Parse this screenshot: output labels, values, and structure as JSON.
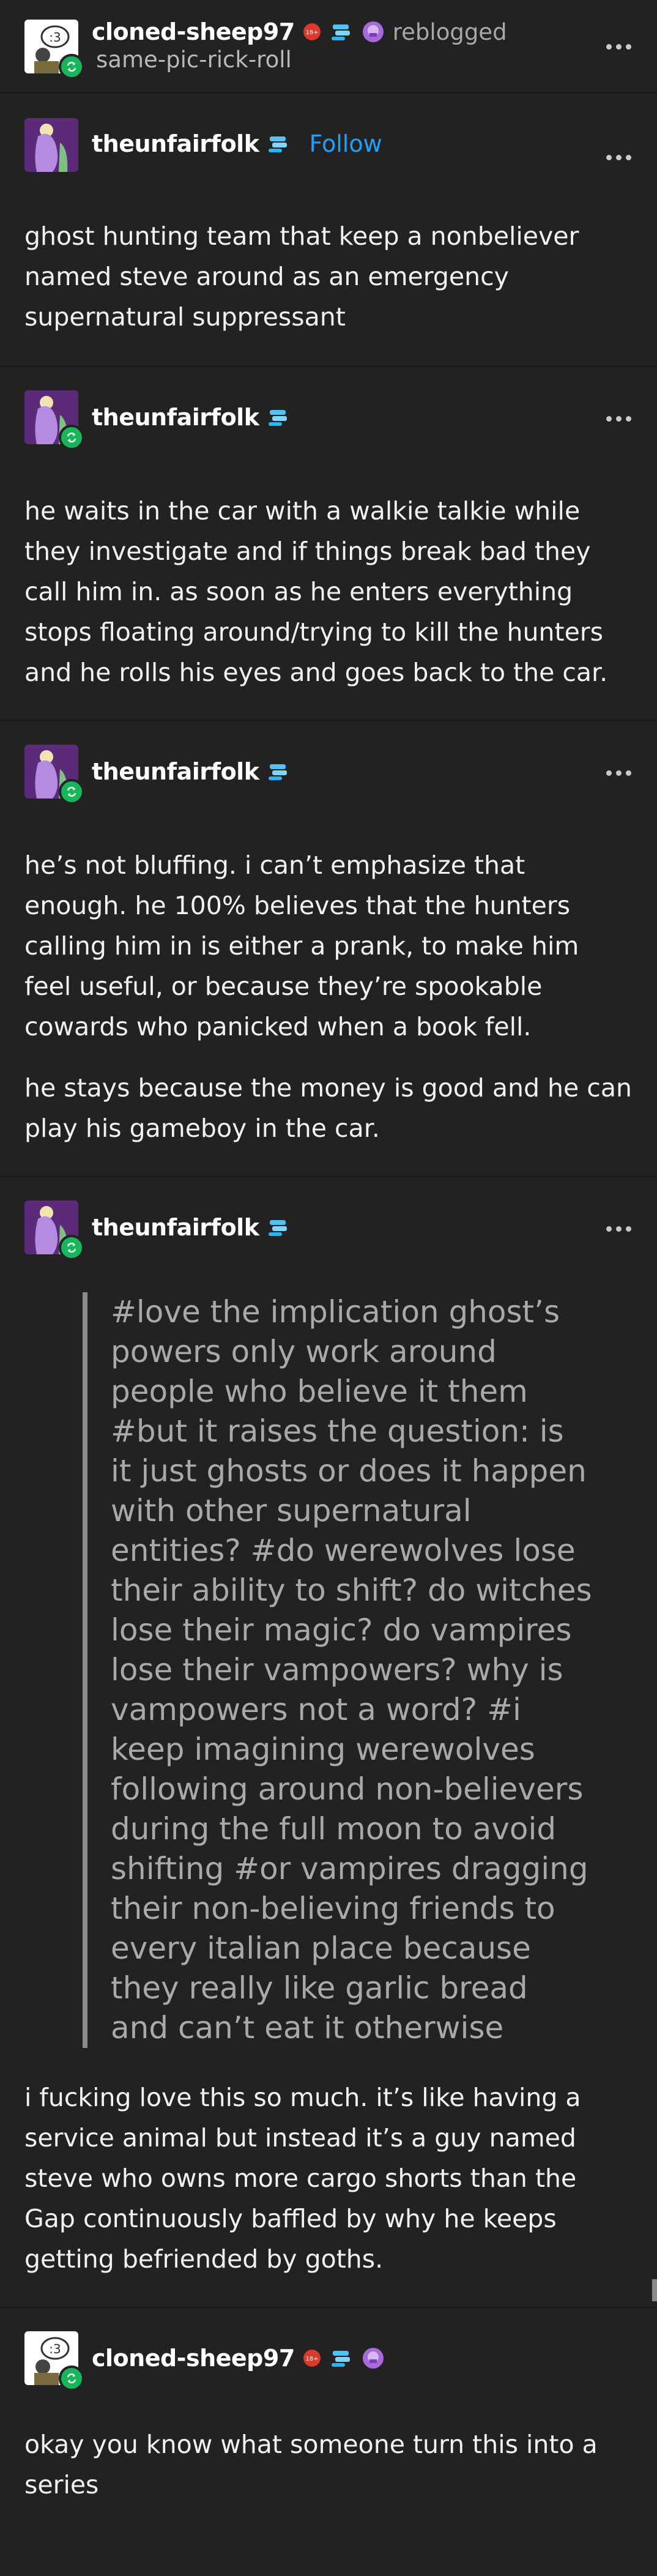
{
  "post_header": {
    "username": "cloned-sheep97",
    "action": "reblogged",
    "subtext": "same-pic-rick-roll"
  },
  "op": {
    "username": "theunfairfolk",
    "follow_label": "Follow",
    "text": "ghost hunting team that keep a nonbeliever named steve around as an emergency supernatural suppressant"
  },
  "reply1": {
    "username": "theunfairfolk",
    "text": "he waits in the car with a walkie talkie while they investigate and if things break bad they call him in. as soon as he enters everything stops floating around/trying to kill the hunters and he rolls his eyes and goes back to the car."
  },
  "reply2": {
    "username": "theunfairfolk",
    "p1": "he’s not bluffing. i can’t emphasize that enough. he 100% believes that the hunters calling him in is either a prank, to make him feel useful, or because they’re spookable cowards who panicked when a book fell.",
    "p2": "he stays because the money is good and he can play his gameboy in the car."
  },
  "reply3": {
    "username": "theunfairfolk",
    "tags": "#love the implication ghost’s powers only work around people who believe it them #but it raises the question: is it just ghosts or does it happen with other supernatural entities? #do werewolves lose their ability to shift? do witches lose their magic? do vampires lose their vampowers? why is vampowers not a word? #i keep imagining werewolves following around non-believers during the full moon to avoid shifting #or vampires dragging their non-believing friends to every italian place because they really like garlic bread and can’t eat it otherwise",
    "text": "i fucking love this so much. it’s like having a service animal but instead it’s a guy named steve who owns more cargo shorts than the Gap continuously baffled by why he keeps getting befriended by goths."
  },
  "reply4": {
    "username": "cloned-sheep97",
    "text": "okay you know what someone turn this into a series"
  },
  "colors": {
    "background": "#222222",
    "follow": "#1ea0ff",
    "reblog_badge": "#17b65a",
    "quote_text": "#a9a9a9"
  },
  "icons": [
    "cloned-sheep-avatar",
    "theunfairfolk-avatar",
    "reblog-icon",
    "adult-badge-icon",
    "blue-scroll-badge-icon",
    "purple-badge-icon",
    "more-options-icon"
  ]
}
